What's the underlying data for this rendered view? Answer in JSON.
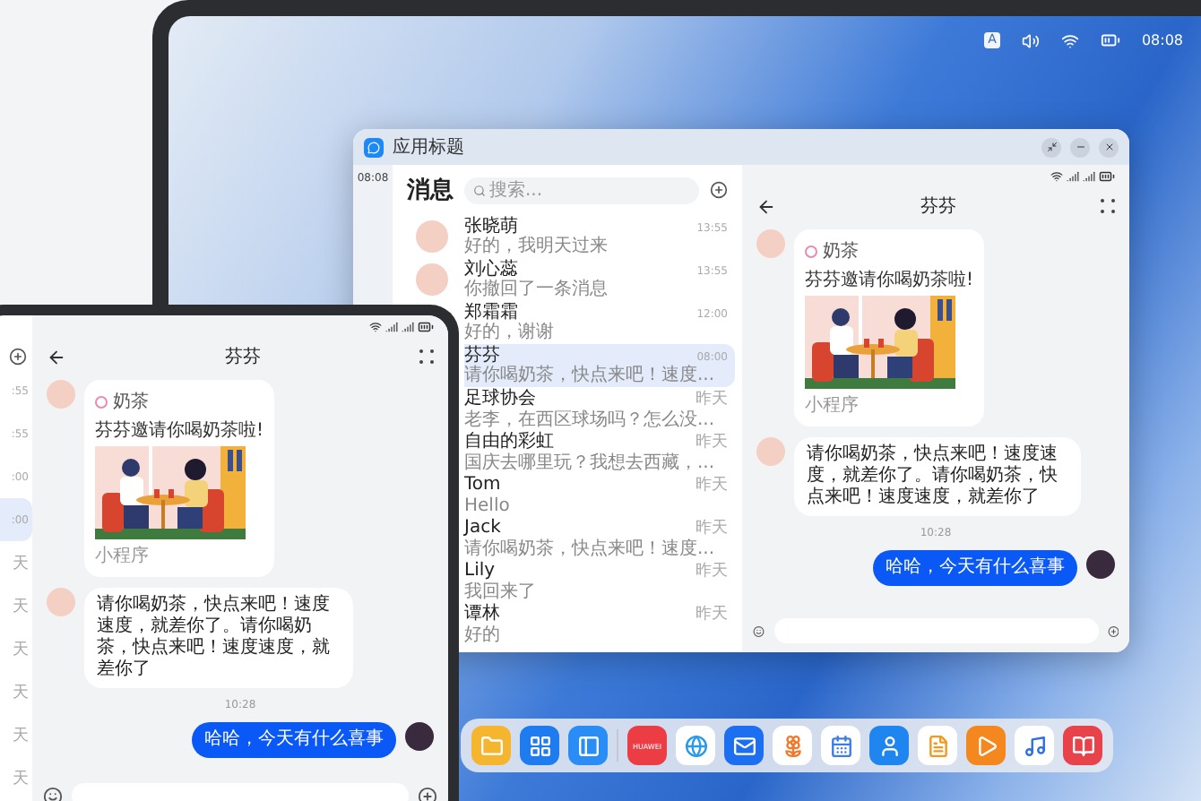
{
  "desktop": {
    "input_method": "A",
    "time": "08:08"
  },
  "window": {
    "title": "应用标题",
    "time": "08:08",
    "list": {
      "title": "消息",
      "search_placeholder": "搜索...",
      "conversations": [
        {
          "name": "张晓萌",
          "preview": "好的，我明天过来",
          "time": "13:55",
          "selected": false,
          "avatar": true
        },
        {
          "name": "刘心蕊",
          "preview": "你撤回了一条消息",
          "time": "13:55",
          "selected": false,
          "avatar": true
        },
        {
          "name": "郑霜霜",
          "preview": "好的，谢谢",
          "time": "12:00",
          "selected": false,
          "avatar": false
        },
        {
          "name": "芬芬",
          "preview": "请你喝奶茶，快点来吧！速度...",
          "time": "08:00",
          "selected": true,
          "avatar": false
        },
        {
          "name": "足球协会",
          "preview": "老李，在西区球场吗？怎么没...",
          "time": "昨天",
          "selected": false,
          "avatar": false
        },
        {
          "name": "自由的彩虹",
          "preview": "国庆去哪里玩？我想去西藏，...",
          "time": "昨天",
          "selected": false,
          "avatar": false
        },
        {
          "name": "Tom",
          "preview": "Hello",
          "time": "昨天",
          "selected": false,
          "avatar": false
        },
        {
          "name": "Jack",
          "preview": "请你喝奶茶，快点来吧！速度...",
          "time": "昨天",
          "selected": false,
          "avatar": false
        },
        {
          "name": "Lily",
          "preview": "我回来了",
          "time": "昨天",
          "selected": false,
          "avatar": false
        },
        {
          "name": "谭林",
          "preview": "好的",
          "time": "昨天",
          "selected": false,
          "avatar": false
        }
      ]
    },
    "chat": {
      "title": "芬芬",
      "messages": [
        {
          "kind": "card",
          "app": "奶茶",
          "text": "芬芬邀请你喝奶茶啦!",
          "footer": "小程序"
        },
        {
          "kind": "received",
          "text": "请你喝奶茶，快点来吧！速度速度，就差你了。请你喝奶茶，快点来吧！速度速度，就差你了"
        },
        {
          "kind": "time",
          "text": "10:28"
        },
        {
          "kind": "sent",
          "text": "哈哈，今天有什么喜事"
        }
      ]
    }
  },
  "tablet": {
    "list": [
      {
        "time": ":55",
        "selected": false
      },
      {
        "time": ":55",
        "selected": false
      },
      {
        "time": ":00",
        "selected": false
      },
      {
        "time": ":00",
        "selected": true
      },
      {
        "time": "天",
        "selected": false
      },
      {
        "time": "天",
        "selected": false
      },
      {
        "time": "天",
        "selected": false
      },
      {
        "time": "天",
        "selected": false
      },
      {
        "time": "天",
        "selected": false
      },
      {
        "time": "天",
        "selected": false
      }
    ],
    "chat": {
      "title": "芬芬",
      "messages": [
        {
          "kind": "card",
          "app": "奶茶",
          "text": "芬芬邀请你喝奶茶啦!",
          "footer": "小程序"
        },
        {
          "kind": "received",
          "text": "请你喝奶茶，快点来吧！速度速度，就差你了。请你喝奶茶，快点来吧！速度速度，就差你了"
        },
        {
          "kind": "time",
          "text": "10:28"
        },
        {
          "kind": "sent",
          "text": "哈哈，今天有什么喜事"
        }
      ]
    }
  },
  "dock": [
    {
      "kind": "folder"
    },
    {
      "kind": "grid"
    },
    {
      "kind": "panel"
    },
    {
      "kind": "separator"
    },
    {
      "kind": "store",
      "label": "HUAWEI"
    },
    {
      "kind": "browser"
    },
    {
      "kind": "mail"
    },
    {
      "kind": "photos"
    },
    {
      "kind": "calendar"
    },
    {
      "kind": "contacts"
    },
    {
      "kind": "docs"
    },
    {
      "kind": "video"
    },
    {
      "kind": "music"
    },
    {
      "kind": "books"
    }
  ]
}
